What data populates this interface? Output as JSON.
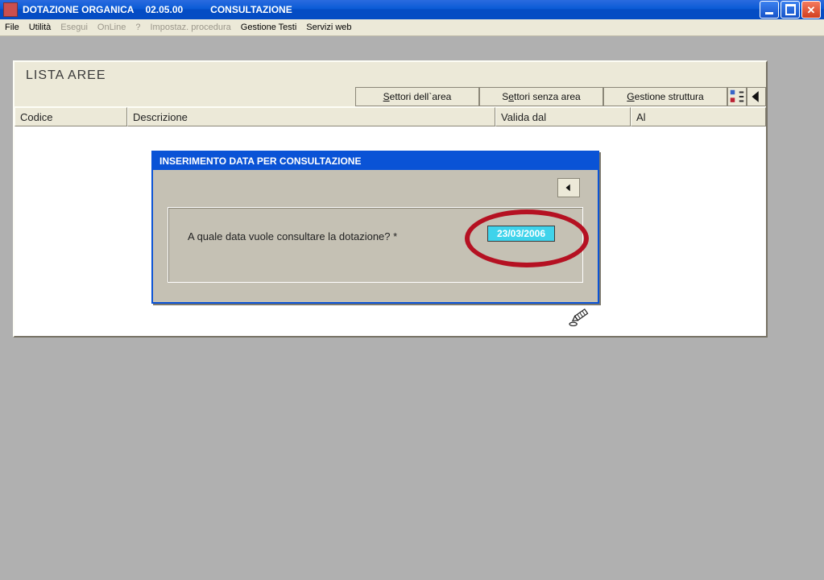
{
  "titlebar": {
    "app": "DOTAZIONE ORGANICA",
    "version": "02.05.00",
    "mode": "CONSULTAZIONE"
  },
  "menu": {
    "file": "File",
    "utilita": "Utilità",
    "esegui": "Esegui",
    "online": "OnLine",
    "help": "?",
    "impostaz": "Impostaz. procedura",
    "gestione_testi": "Gestione Testi",
    "servizi_web": "Servizi web"
  },
  "panel": {
    "title": "LISTA AREE",
    "tabs": {
      "settori_area": "Settori dell`area",
      "settori_senza_area": "Settori senza area",
      "gestione_struttura": "Gestione struttura"
    },
    "columns": {
      "codice": "Codice",
      "descrizione": "Descrizione",
      "valida_dal": "Valida dal",
      "al": "Al"
    }
  },
  "dialog": {
    "title": "INSERIMENTO DATA PER CONSULTAZIONE",
    "question": "A quale data vuole consultare la dotazione?  *",
    "date_value": "23/03/2006"
  }
}
